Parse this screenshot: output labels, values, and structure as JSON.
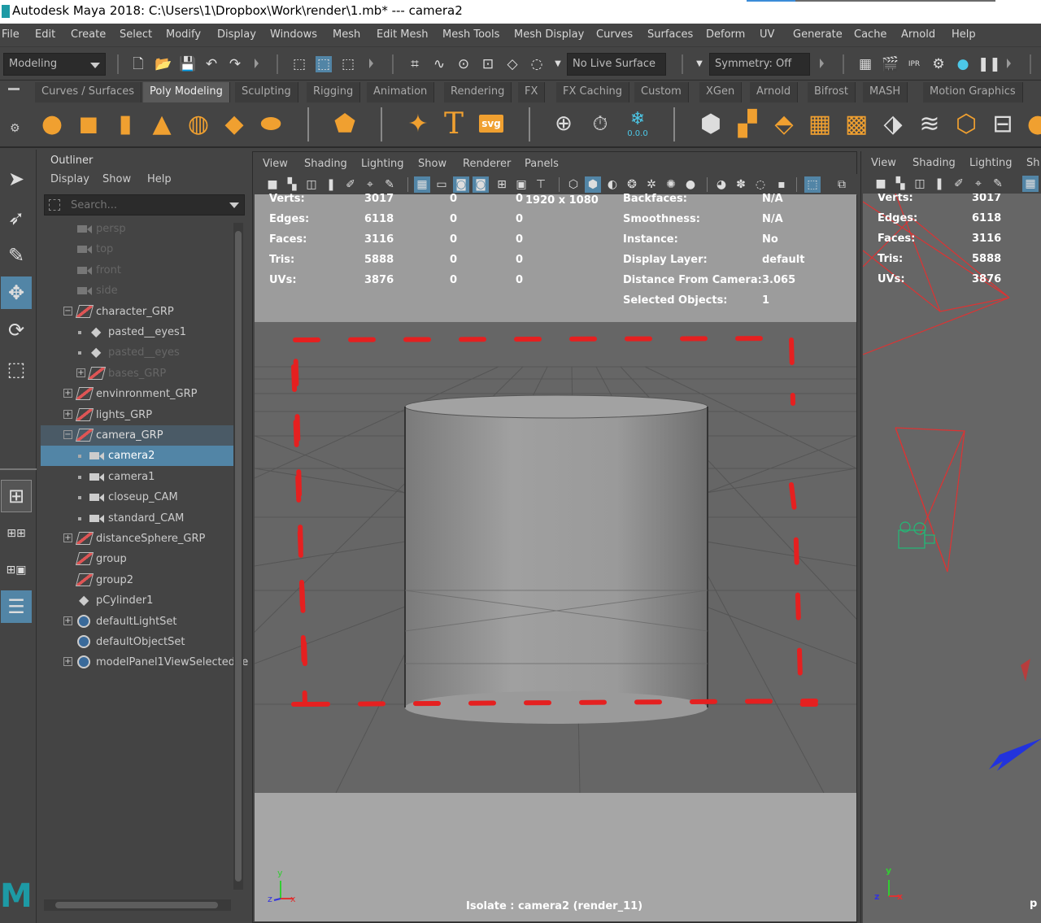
{
  "window": {
    "title": "Autodesk Maya 2018: C:\\Users\\1\\Dropbox\\Work\\render\\1.mb*   ---   camera2"
  },
  "menubar": [
    "File",
    "Edit",
    "Create",
    "Select",
    "Modify",
    "Display",
    "Windows",
    "Mesh",
    "Edit Mesh",
    "Mesh Tools",
    "Mesh Display",
    "Curves",
    "Surfaces",
    "Deform",
    "UV",
    "Generate",
    "Cache",
    "Arnold",
    "Help"
  ],
  "statusline": {
    "mode": "Modeling",
    "live_surface": "No Live Surface",
    "symmetry": "Symmetry: Off"
  },
  "shelf_tabs": [
    {
      "label": "Curves / Surfaces",
      "active": false
    },
    {
      "label": "Poly Modeling",
      "active": true
    },
    {
      "label": "Sculpting",
      "active": false
    },
    {
      "label": "Rigging",
      "active": false
    },
    {
      "label": "Animation",
      "active": false
    },
    {
      "label": "Rendering",
      "active": false
    },
    {
      "label": "FX",
      "active": false
    },
    {
      "label": "FX Caching",
      "active": false
    },
    {
      "label": "Custom",
      "active": false
    },
    {
      "label": "XGen",
      "active": false
    },
    {
      "label": "Arnold",
      "active": false
    },
    {
      "label": "Bifrost",
      "active": false
    },
    {
      "label": "MASH",
      "active": false
    },
    {
      "label": "Motion Graphics",
      "active": false
    }
  ],
  "shelf": {
    "text_tool": "T",
    "svg_tool": "svg",
    "snow_value": "0.0.0"
  },
  "outliner": {
    "title": "Outliner",
    "menu": [
      "Display",
      "Show",
      "Help"
    ],
    "search_placeholder": "Search...",
    "items": [
      {
        "label": "persp",
        "type": "cam",
        "indent": 0,
        "dim": true
      },
      {
        "label": "top",
        "type": "cam",
        "indent": 0,
        "dim": true
      },
      {
        "label": "front",
        "type": "cam",
        "indent": 0,
        "dim": true
      },
      {
        "label": "side",
        "type": "cam",
        "indent": 0,
        "dim": true
      },
      {
        "label": "character_GRP",
        "type": "grp",
        "indent": 0,
        "expand": "−"
      },
      {
        "label": "pasted__eyes1",
        "type": "mesh",
        "indent": 1
      },
      {
        "label": "pasted__eyes",
        "type": "mesh",
        "indent": 1,
        "dim": true
      },
      {
        "label": "bases_GRP",
        "type": "grp",
        "indent": 1,
        "dim": true,
        "expand": "+"
      },
      {
        "label": "envinronment_GRP",
        "type": "grp",
        "indent": 0,
        "expand": "+"
      },
      {
        "label": "lights_GRP",
        "type": "grp",
        "indent": 0,
        "expand": "+"
      },
      {
        "label": "camera_GRP",
        "type": "grp",
        "indent": 0,
        "expand": "−",
        "sel2": true
      },
      {
        "label": "camera2",
        "type": "cam",
        "indent": 1,
        "sel": true
      },
      {
        "label": "camera1",
        "type": "cam",
        "indent": 1
      },
      {
        "label": "closeup_CAM",
        "type": "cam",
        "indent": 1
      },
      {
        "label": "standard_CAM",
        "type": "cam",
        "indent": 1
      },
      {
        "label": "distanceSphere_GRP",
        "type": "grp",
        "indent": 0,
        "expand": "+"
      },
      {
        "label": "group",
        "type": "grp",
        "indent": 0
      },
      {
        "label": "group2",
        "type": "grp",
        "indent": 0
      },
      {
        "label": "pCylinder1",
        "type": "mesh",
        "indent": 0
      },
      {
        "label": "defaultLightSet",
        "type": "set",
        "indent": 0,
        "expand": "+"
      },
      {
        "label": "defaultObjectSet",
        "type": "set",
        "indent": 0
      },
      {
        "label": "modelPanel1ViewSelectedSe",
        "type": "set",
        "indent": 0,
        "expand": "+"
      }
    ]
  },
  "viewport": {
    "menu": [
      "View",
      "Shading",
      "Lighting",
      "Show",
      "Renderer",
      "Panels"
    ],
    "hud_left": {
      "labels": [
        "Verts:",
        "Edges:",
        "Faces:",
        "Tris:",
        "UVs:"
      ],
      "col1": [
        "3017",
        "6118",
        "3116",
        "5888",
        "3876"
      ],
      "col2": [
        "0",
        "0",
        "0",
        "0",
        "0"
      ],
      "col3": [
        "0",
        "0",
        "0",
        "0",
        "0"
      ]
    },
    "resolution": "1920 x 1080",
    "hud_right": {
      "labels": [
        "Backfaces:",
        "Smoothness:",
        "Instance:",
        "Display Layer:",
        "Distance From Camera:",
        "Selected Objects:"
      ],
      "values": [
        "N/A",
        "N/A",
        "No",
        "default",
        "3.065",
        "1"
      ]
    },
    "isolate": "Isolate : camera2 (render_11)",
    "axis": {
      "x": "x",
      "y": "y",
      "z": "z"
    }
  },
  "viewport2": {
    "menu": [
      "View",
      "Shading",
      "Lighting",
      "Sh"
    ],
    "labels": [
      "Verts:",
      "Edges:",
      "Faces:",
      "Tris:",
      "UVs:"
    ],
    "values": [
      "3017",
      "6118",
      "3116",
      "5888",
      "3876"
    ],
    "corner": "p",
    "axis": {
      "x": "x",
      "y": "y",
      "z": "z"
    }
  }
}
